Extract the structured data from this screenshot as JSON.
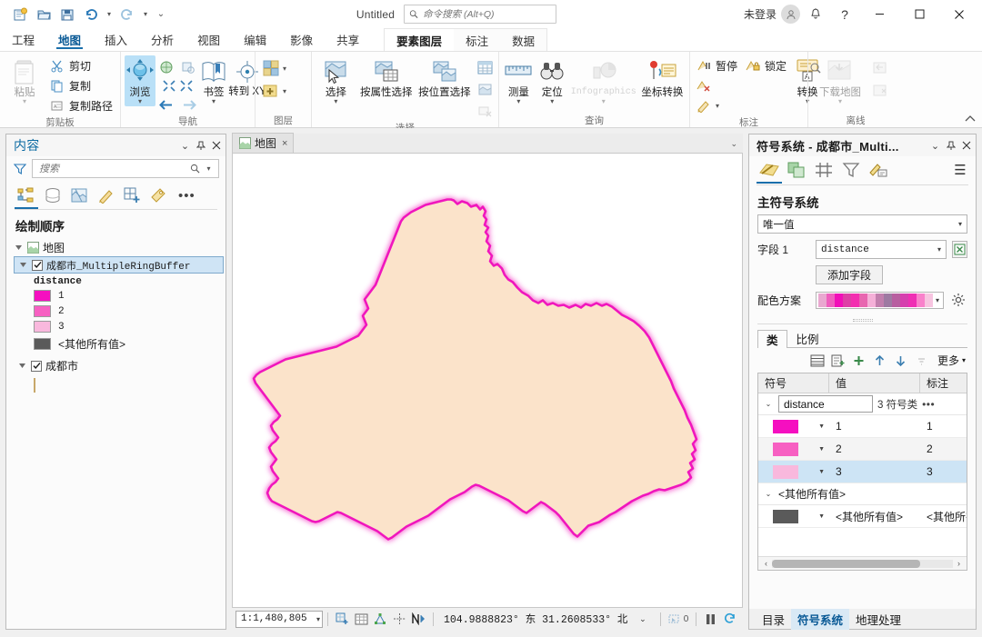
{
  "titlebar": {
    "doc_title": "Untitled",
    "search_placeholder": "命令搜索 (Alt+Q)",
    "signin_label": "未登录",
    "qat": [
      {
        "name": "new-project-icon",
        "tip": "新建"
      },
      {
        "name": "open-project-icon",
        "tip": "打开"
      },
      {
        "name": "save-project-icon",
        "tip": "保存"
      },
      {
        "name": "undo-icon",
        "tip": "撤销"
      },
      {
        "name": "redo-icon",
        "tip": "恢复"
      },
      {
        "name": "customize-qat-icon",
        "tip": "自定义快速访问工具栏"
      }
    ],
    "window_buttons": {
      "minimize": "—",
      "maximize": "□",
      "close": "×"
    },
    "help_label": "?"
  },
  "ribbon": {
    "tabs": [
      {
        "label": "工程",
        "active": false
      },
      {
        "label": "地图",
        "active": true
      },
      {
        "label": "插入",
        "active": false
      },
      {
        "label": "分析",
        "active": false
      },
      {
        "label": "视图",
        "active": false
      },
      {
        "label": "编辑",
        "active": false
      },
      {
        "label": "影像",
        "active": false
      },
      {
        "label": "共享",
        "active": false
      }
    ],
    "context_tabs": [
      {
        "label": "要素图层",
        "active": true
      },
      {
        "label": "标注",
        "active": false
      },
      {
        "label": "数据",
        "active": false
      }
    ],
    "groups": [
      {
        "label": "剪贴板",
        "big": [
          {
            "label": "粘贴",
            "icon": "paste-icon",
            "caret": true,
            "disabled": true
          }
        ],
        "small": [
          {
            "label": "剪切",
            "icon": "cut-icon"
          },
          {
            "label": "复制",
            "icon": "copy-icon"
          },
          {
            "label": "复制路径",
            "icon": "copy-path-icon"
          }
        ]
      },
      {
        "label": "导航",
        "big": [
          {
            "label": "浏览",
            "icon": "explore-icon",
            "caret": true,
            "selected": true
          },
          {
            "label": "书签",
            "icon": "bookmarks-icon",
            "caret": true
          },
          {
            "label": "转到 XY",
            "icon": "go-to-xy-icon",
            "caret": false
          }
        ]
      },
      {
        "label": "图层",
        "small": [
          {
            "label": "",
            "icon": "basemap-icon",
            "caret": true
          },
          {
            "label": "",
            "icon": "add-data-icon",
            "caret": true
          }
        ]
      },
      {
        "label": "选择",
        "big": [
          {
            "label": "选择",
            "icon": "select-icon",
            "caret": true
          },
          {
            "label": "按属性选择",
            "icon": "select-by-attributes-icon"
          },
          {
            "label": "按位置选择",
            "icon": "select-by-location-icon"
          }
        ]
      },
      {
        "label": "查询",
        "big": [
          {
            "label": "测量",
            "icon": "measure-icon",
            "caret": true
          },
          {
            "label": "定位",
            "icon": "locate-icon",
            "caret": true
          },
          {
            "label": "Infographics",
            "icon": "infographics-icon",
            "caret": true,
            "disabled": true
          },
          {
            "label": "坐标转换",
            "icon": "coordinate-conversion-icon"
          }
        ]
      },
      {
        "label": "标注",
        "big": [
          {
            "label": "转换",
            "icon": "convert-labels-icon",
            "caret": true
          }
        ],
        "small": [
          {
            "label": "暂停",
            "icon": "pause-labeling-icon"
          },
          {
            "label": "锁定",
            "icon": "lock-labeling-icon"
          },
          {
            "label": "",
            "icon": "clear-labels-icon"
          },
          {
            "label": "",
            "icon": "label-edit-icon",
            "caret": true
          }
        ]
      },
      {
        "label": "离线",
        "big": [
          {
            "label": "下载地图",
            "icon": "download-map-icon",
            "caret": true,
            "disabled": true
          }
        ]
      }
    ]
  },
  "contents": {
    "title": "内容",
    "search_placeholder": "搜索",
    "tools": [
      {
        "name": "list-by-drawing-order-icon",
        "active": true
      },
      {
        "name": "list-by-data-source-icon",
        "active": false
      },
      {
        "name": "list-by-selection-icon",
        "active": false
      },
      {
        "name": "list-by-editing-icon",
        "active": false
      },
      {
        "name": "list-by-snapping-icon",
        "active": false
      },
      {
        "name": "list-by-labeling-icon",
        "active": false
      }
    ],
    "more_label": "•••",
    "heading": "绘制顺序",
    "map_node": "地图",
    "layers": [
      {
        "name": "成都市_MultipleRingBuffer",
        "checked": true,
        "selected": true,
        "field": "distance",
        "classes": [
          {
            "label": "1",
            "color": "#f50fc0"
          },
          {
            "label": "2",
            "color": "#f760c2"
          },
          {
            "label": "3",
            "color": "#f9b8dd"
          },
          {
            "label": "<其他所有值>",
            "color": "#5a5a5a"
          }
        ]
      },
      {
        "name": "成都市",
        "checked": true,
        "selected": false,
        "classes": [
          {
            "label": "",
            "color": "#fae2b8"
          }
        ]
      }
    ]
  },
  "map": {
    "tab_label": "地图",
    "close_label": "×",
    "scale": "1:1,480,805",
    "coordinates": "104.9888823° 东  31.2608533° 北",
    "selected_count": "0",
    "fill_color": "#fbe3ca",
    "outline_color": "#f013bd",
    "glow_color": "#f9a8e0",
    "status_tools": [
      {
        "name": "new-map-view-icon"
      },
      {
        "name": "attribute-table-icon"
      },
      {
        "name": "snapping-icon"
      },
      {
        "name": "crosshair-icon"
      },
      {
        "name": "north-arrow-icon"
      },
      {
        "name": "clear-selection-icon"
      },
      {
        "name": "pause-drawing-icon"
      },
      {
        "name": "refresh-icon"
      }
    ]
  },
  "symbology": {
    "title": "符号系统 - 成都市_Multi...",
    "tabs": [
      {
        "name": "primary-symbology-icon",
        "active": true
      },
      {
        "name": "vary-symbology-icon",
        "active": false
      },
      {
        "name": "symbol-layer-drawing-icon",
        "active": false
      },
      {
        "name": "mask-icon",
        "active": false
      },
      {
        "name": "label-symbology-icon",
        "active": false
      }
    ],
    "menu_label": "☰",
    "primary_heading": "主符号系统",
    "primary_value": "唯一值",
    "field_label": "字段 1",
    "field_value": "distance",
    "expression_icon": "set-expression-icon",
    "add_field_label": "添加字段",
    "color_scheme_label": "配色方案",
    "color_scheme_stops": [
      "#e9a8d0",
      "#ef5fbe",
      "#f10fb8",
      "#de3fa6",
      "#f32fb0",
      "#e866b0",
      "#f5b0d8",
      "#c27fae",
      "#9e7aa2",
      "#b85fa0",
      "#d63fae",
      "#ef2fb4",
      "#f981cb",
      "#f7c4e0"
    ],
    "gear_icon": "color-scheme-options-icon",
    "class_tabs": [
      {
        "label": "类",
        "active": true
      },
      {
        "label": "比例",
        "active": false
      }
    ],
    "table_tools": [
      {
        "name": "list-view-icon",
        "disabled": false
      },
      {
        "name": "add-all-values-icon",
        "disabled": false
      },
      {
        "name": "add-value-icon",
        "disabled": false
      },
      {
        "name": "move-up-icon",
        "disabled": false
      },
      {
        "name": "move-down-icon",
        "disabled": false
      },
      {
        "name": "sort-icon",
        "disabled": true
      }
    ],
    "more_label": "更多",
    "columns": [
      "符号",
      "值",
      "标注"
    ],
    "group_row": {
      "field": "distance",
      "count_label": "3 符号类",
      "dots": "•••"
    },
    "rows": [
      {
        "color": "#f50fc0",
        "value": "1",
        "label": "1",
        "selected": false
      },
      {
        "color": "#f760c2",
        "value": "2",
        "label": "2",
        "selected": false
      },
      {
        "color": "#f9b8dd",
        "value": "3",
        "label": "3",
        "selected": true
      }
    ],
    "other_group": {
      "title": "<其他所有值>",
      "color": "#5a5a5a",
      "value": "<其他所有值>",
      "label": "<其他所有"
    },
    "bottom_tabs": [
      {
        "label": "目录",
        "active": false
      },
      {
        "label": "符号系统",
        "active": true
      },
      {
        "label": "地理处理",
        "active": false
      }
    ]
  }
}
